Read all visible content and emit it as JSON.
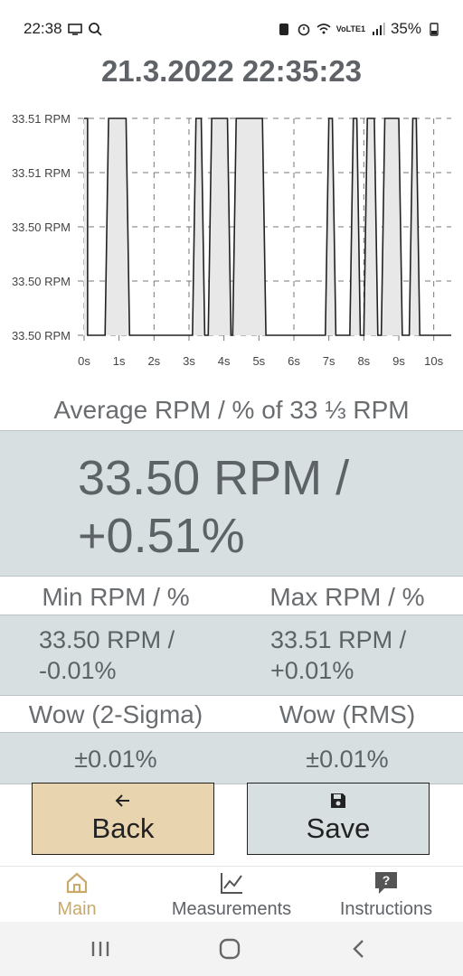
{
  "status_bar": {
    "time": "22:38",
    "battery": "35%",
    "network": "VoLTE1"
  },
  "header": {
    "timestamp": "21.3.2022 22:35:23"
  },
  "chart_data": {
    "type": "line",
    "title": "",
    "xlabel": "",
    "ylabel": "",
    "x_ticks": [
      "0s",
      "1s",
      "2s",
      "3s",
      "4s",
      "5s",
      "6s",
      "7s",
      "8s",
      "9s",
      "10s"
    ],
    "y_ticks": [
      "33.51 RPM",
      "33.51 RPM",
      "33.50 RPM",
      "33.50 RPM",
      "33.50 RPM"
    ],
    "xlim": [
      0,
      10.5
    ],
    "ylim": [
      33.5,
      33.51
    ],
    "grid": true,
    "series": [
      {
        "x": [
          0,
          0.1,
          0.1,
          0.6,
          0.7,
          1.2,
          1.3,
          3.1,
          3.2,
          3.35,
          3.45,
          3.55,
          3.65,
          4.1,
          4.2,
          4.25,
          4.35,
          5.1,
          5.2,
          5.3,
          5.4,
          6.9,
          7.0,
          7.1,
          7.2,
          7.6,
          7.7,
          7.8,
          7.9,
          8.0,
          8.1,
          8.3,
          8.4,
          8.5,
          8.6,
          9.0,
          9.1,
          9.3,
          9.4,
          9.5,
          9.6,
          10.5
        ],
        "values": [
          33.51,
          33.51,
          33.5,
          33.5,
          33.51,
          33.51,
          33.5,
          33.5,
          33.51,
          33.51,
          33.5,
          33.5,
          33.51,
          33.51,
          33.5,
          33.5,
          33.51,
          33.51,
          33.5,
          33.5,
          33.5,
          33.5,
          33.51,
          33.51,
          33.5,
          33.5,
          33.51,
          33.51,
          33.5,
          33.5,
          33.51,
          33.51,
          33.5,
          33.5,
          33.51,
          33.51,
          33.5,
          33.5,
          33.51,
          33.51,
          33.5,
          33.5
        ]
      }
    ]
  },
  "average": {
    "label": "Average RPM / % of 33 ⅓ RPM",
    "value_line1": "33.50 RPM /",
    "value_line2": "+0.51%"
  },
  "min": {
    "label": "Min RPM / %",
    "line1": "33.50 RPM /",
    "line2": "-0.01%"
  },
  "max": {
    "label": "Max RPM / %",
    "line1": "33.51 RPM /",
    "line2": "+0.01%"
  },
  "wow_2sigma": {
    "label": "Wow (2-Sigma)",
    "value": "±0.01%"
  },
  "wow_rms": {
    "label": "Wow (RMS)",
    "value": "±0.01%"
  },
  "buttons": {
    "back": "Back",
    "save": "Save"
  },
  "nav": {
    "main": "Main",
    "measurements": "Measurements",
    "instructions": "Instructions",
    "active_color": "#c9a96a"
  }
}
